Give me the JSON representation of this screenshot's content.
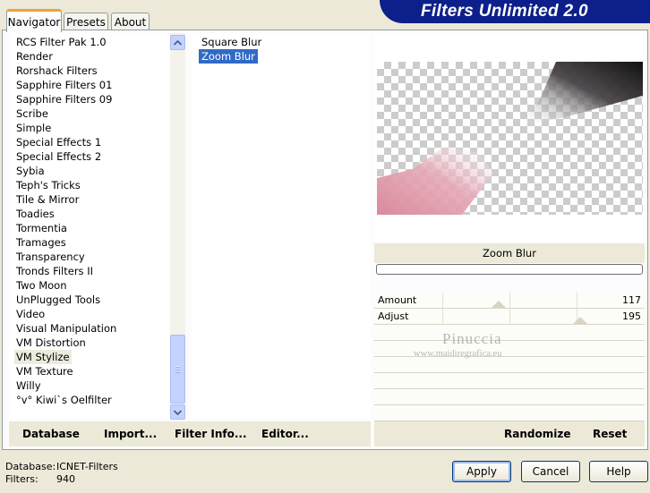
{
  "app": {
    "title": "Filters Unlimited 2.0"
  },
  "tabs": [
    {
      "label": "Navigator",
      "active": true
    },
    {
      "label": "Presets",
      "active": false
    },
    {
      "label": "About",
      "active": false
    }
  ],
  "categories": {
    "items": [
      "RCS Filter Pak 1.0",
      "Render",
      "Rorshack Filters",
      "Sapphire Filters 01",
      "Sapphire Filters 09",
      "Scribe",
      "Simple",
      "Special Effects 1",
      "Special Effects 2",
      "Sybia",
      "Teph's Tricks",
      "Tile & Mirror",
      "Toadies",
      "Tormentia",
      "Tramages",
      "Transparency",
      "Tronds Filters II",
      "Two Moon",
      "UnPlugged Tools",
      "Video",
      "Visual Manipulation",
      "VM Distortion",
      "VM Stylize",
      "VM Texture",
      "Willy",
      "°v° Kiwi`s Oelfilter"
    ],
    "selected": "VM Stylize"
  },
  "filters": {
    "items": [
      "Square Blur",
      "Zoom Blur"
    ],
    "selected": "Zoom Blur"
  },
  "preview": {
    "filter_name": "Zoom Blur",
    "progress": 0
  },
  "parameters": [
    {
      "label": "Amount",
      "value": "117",
      "max": 255
    },
    {
      "label": "Adjust",
      "value": "195",
      "max": 255
    }
  ],
  "watermark": {
    "line1": "Pinuccia",
    "line2": "www.maidiregrafica.eu"
  },
  "toolbar": {
    "database": "Database",
    "import": "Import...",
    "filter_info": "Filter Info...",
    "editor": "Editor...",
    "randomize": "Randomize",
    "reset": "Reset"
  },
  "status": {
    "database_label": "Database:",
    "database_value": "ICNET-Filters",
    "filters_label": "Filters:",
    "filters_value": "940"
  },
  "buttons": {
    "apply": "Apply",
    "cancel": "Cancel",
    "help": "Help"
  },
  "icons": {
    "scroll_up": "chevron-up-icon",
    "scroll_down": "chevron-down-icon"
  }
}
